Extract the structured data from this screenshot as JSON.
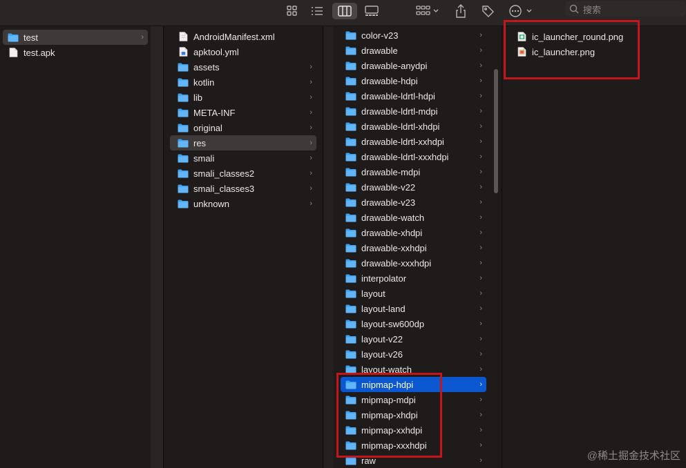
{
  "toolbar": {
    "search_placeholder": "搜索",
    "buttons": [
      "icon-view-icon",
      "list-view-icon",
      "column-view-icon",
      "gallery-view-icon",
      "group-icon",
      "share-icon",
      "tag-icon",
      "more-icon"
    ]
  },
  "sidebar": {
    "items": [
      {
        "label": "test",
        "type": "folder",
        "selected": true
      },
      {
        "label": "test.apk",
        "type": "file",
        "selected": false
      }
    ]
  },
  "column2": {
    "items": [
      {
        "label": "AndroidManifest.xml",
        "type": "xml"
      },
      {
        "label": "apktool.yml",
        "type": "yml"
      },
      {
        "label": "assets",
        "type": "folder"
      },
      {
        "label": "kotlin",
        "type": "folder"
      },
      {
        "label": "lib",
        "type": "folder"
      },
      {
        "label": "META-INF",
        "type": "folder"
      },
      {
        "label": "original",
        "type": "folder"
      },
      {
        "label": "res",
        "type": "folder",
        "selected": true
      },
      {
        "label": "smali",
        "type": "folder"
      },
      {
        "label": "smali_classes2",
        "type": "folder"
      },
      {
        "label": "smali_classes3",
        "type": "folder"
      },
      {
        "label": "unknown",
        "type": "folder"
      }
    ]
  },
  "column3": {
    "items": [
      {
        "label": "color-v23"
      },
      {
        "label": "drawable"
      },
      {
        "label": "drawable-anydpi"
      },
      {
        "label": "drawable-hdpi"
      },
      {
        "label": "drawable-ldrtl-hdpi"
      },
      {
        "label": "drawable-ldrtl-mdpi"
      },
      {
        "label": "drawable-ldrtl-xhdpi"
      },
      {
        "label": "drawable-ldrtl-xxhdpi"
      },
      {
        "label": "drawable-ldrtl-xxxhdpi"
      },
      {
        "label": "drawable-mdpi"
      },
      {
        "label": "drawable-v22"
      },
      {
        "label": "drawable-v23"
      },
      {
        "label": "drawable-watch"
      },
      {
        "label": "drawable-xhdpi"
      },
      {
        "label": "drawable-xxhdpi"
      },
      {
        "label": "drawable-xxxhdpi"
      },
      {
        "label": "interpolator"
      },
      {
        "label": "layout"
      },
      {
        "label": "layout-land"
      },
      {
        "label": "layout-sw600dp"
      },
      {
        "label": "layout-v22"
      },
      {
        "label": "layout-v26"
      },
      {
        "label": "layout-watch"
      },
      {
        "label": "mipmap-hdpi",
        "selected": true
      },
      {
        "label": "mipmap-mdpi"
      },
      {
        "label": "mipmap-xhdpi"
      },
      {
        "label": "mipmap-xxhdpi"
      },
      {
        "label": "mipmap-xxxhdpi"
      },
      {
        "label": "raw"
      }
    ]
  },
  "column4": {
    "items": [
      {
        "label": "ic_launcher_round.png",
        "type": "png-round"
      },
      {
        "label": "ic_launcher.png",
        "type": "png"
      }
    ]
  },
  "colors": {
    "selection_blue": "#0b57d0",
    "folder_blue": "#3aa0f0",
    "highlight_red": "#c4161c"
  },
  "watermark": "@稀土掘金技术社区"
}
